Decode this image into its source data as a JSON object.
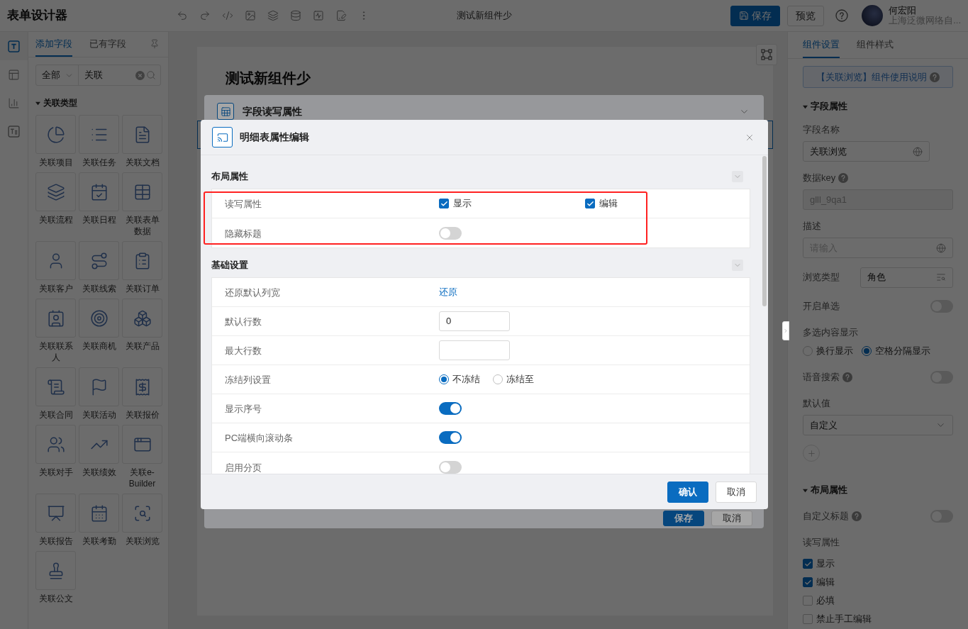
{
  "app_title": "表单设计器",
  "document_title": "测试新组件少",
  "header_buttons": [
    {
      "label": "保存",
      "kind": "primary"
    },
    {
      "label": "预览",
      "kind": "default"
    }
  ],
  "user": {
    "name": "何宏阳",
    "organization": "上海泛微网络自..."
  },
  "rail": [
    {
      "kind": "text",
      "selected": true
    },
    {
      "kind": "layout",
      "selected": false
    },
    {
      "kind": "chart",
      "selected": false
    },
    {
      "kind": "rich-text",
      "selected": false
    }
  ],
  "field_panel": {
    "tabs": [
      {
        "label": "添加字段",
        "selected": true
      },
      {
        "label": "已有字段",
        "selected": false
      }
    ],
    "filter": {
      "scope": "全部",
      "query": "关联"
    },
    "group": {
      "label": "关联类型",
      "expanded": true,
      "items": [
        {
          "label": "关联项目",
          "kind": "project"
        },
        {
          "label": "关联任务",
          "kind": "task"
        },
        {
          "label": "关联文档",
          "kind": "document"
        },
        {
          "label": "关联流程",
          "kind": "process"
        },
        {
          "label": "关联日程",
          "kind": "schedule"
        },
        {
          "label": "关联表单数据",
          "kind": "form-data"
        },
        {
          "label": "关联客户",
          "kind": "customer"
        },
        {
          "label": "关联线索",
          "kind": "lead"
        },
        {
          "label": "关联订单",
          "kind": "order"
        },
        {
          "label": "关联联系人",
          "kind": "contact"
        },
        {
          "label": "关联商机",
          "kind": "opportunity"
        },
        {
          "label": "关联产品",
          "kind": "product"
        },
        {
          "label": "关联合同",
          "kind": "contract"
        },
        {
          "label": "关联活动",
          "kind": "activity"
        },
        {
          "label": "关联报价",
          "kind": "quote"
        },
        {
          "label": "关联对手",
          "kind": "competitor"
        },
        {
          "label": "关联绩效",
          "kind": "performance"
        },
        {
          "label": "关联e-Builder",
          "kind": "e-builder"
        },
        {
          "label": "关联报告",
          "kind": "report"
        },
        {
          "label": "关联考勤",
          "kind": "attendance"
        },
        {
          "label": "关联浏览",
          "kind": "browse"
        },
        {
          "label": "关联公文",
          "kind": "official-document"
        }
      ]
    }
  },
  "canvas": {
    "form_title": "测试新组件少"
  },
  "background_dialog": {
    "title": "字段读写属性",
    "buttons": [
      {
        "label": "保存",
        "kind": "primary"
      },
      {
        "label": "取消",
        "kind": "default"
      }
    ]
  },
  "modal": {
    "title": "明细表属性编辑",
    "sections": [
      {
        "title": "布局属性",
        "expanded": true,
        "rows": [
          {
            "label": "读写属性",
            "kind": "checkboxes",
            "options": [
              {
                "label": "显示",
                "checked": true
              },
              {
                "label": "编辑",
                "checked": true
              }
            ]
          },
          {
            "label": "隐藏标题",
            "kind": "switch",
            "on": false
          }
        ]
      },
      {
        "title": "基础设置",
        "expanded": true,
        "rows": [
          {
            "label": "还原默认列宽",
            "kind": "link",
            "link": "还原"
          },
          {
            "label": "默认行数",
            "kind": "input",
            "value": "0"
          },
          {
            "label": "最大行数",
            "kind": "input"
          },
          {
            "label": "冻结列设置",
            "kind": "radios",
            "options": [
              {
                "label": "不冻结",
                "selected": true
              },
              {
                "label": "冻结至",
                "selected": false
              }
            ]
          },
          {
            "label": "显示序号",
            "kind": "switch",
            "on": true
          },
          {
            "label": "PC端横向滚动条",
            "kind": "switch",
            "on": true
          },
          {
            "label": "启用分页",
            "kind": "switch",
            "on": false
          }
        ]
      }
    ],
    "buttons": [
      {
        "label": "确认",
        "kind": "primary"
      },
      {
        "label": "取消",
        "kind": "default"
      }
    ]
  },
  "settings_panel": {
    "tabs": [
      {
        "label": "组件设置",
        "selected": true
      },
      {
        "label": "组件样式",
        "selected": false
      }
    ],
    "help_link": "【关联浏览】组件使用说明",
    "sections": [
      {
        "title": "字段属性",
        "expanded": true,
        "items": [
          {
            "kind": "name-input",
            "label": "字段名称",
            "value": "关联浏览"
          },
          {
            "kind": "readonly-input",
            "label": "数据key",
            "help": true,
            "value": "glll_9qa1"
          },
          {
            "kind": "i18n-input",
            "label": "描述",
            "placeholder": "请输入"
          },
          {
            "kind": "picker",
            "label": "浏览类型",
            "value": "角色"
          },
          {
            "kind": "switch",
            "label": "开启单选",
            "on": false
          },
          {
            "kind": "radios",
            "label": "多选内容显示",
            "options": [
              {
                "label": "换行显示",
                "selected": false
              },
              {
                "label": "空格分隔显示",
                "selected": true
              }
            ]
          },
          {
            "kind": "switch",
            "label": "语音搜索",
            "help": true,
            "on": false
          },
          {
            "kind": "select",
            "label": "默认值",
            "value": "自定义"
          },
          {
            "kind": "add-button"
          }
        ]
      },
      {
        "title": "布局属性",
        "expanded": true,
        "items": [
          {
            "kind": "switch",
            "label": "自定义标题",
            "help": true,
            "on": false
          },
          {
            "kind": "checklist",
            "label": "读写属性",
            "options": [
              {
                "label": "显示",
                "checked": true
              },
              {
                "label": "编辑",
                "checked": true
              },
              {
                "label": "必填",
                "checked": false
              },
              {
                "label": "禁止手工编辑",
                "checked": false
              }
            ]
          }
        ]
      }
    ]
  }
}
